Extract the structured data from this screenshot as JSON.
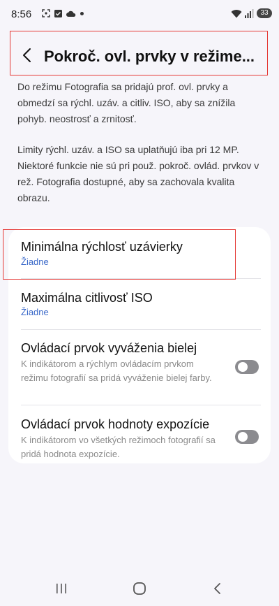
{
  "status_bar": {
    "time": "8:56",
    "battery": "33",
    "left_icons": [
      "screenshot-icon",
      "checkbox-icon",
      "cloud-icon",
      "dot-icon"
    ],
    "right_icons": [
      "wifi-icon",
      "signal-icon",
      "battery-icon"
    ]
  },
  "header": {
    "title": "Pokroč. ovl. prvky v režime..."
  },
  "description": {
    "paragraph1": "Do režimu Fotografia sa pridajú prof. ovl. prvky a obmedzí sa rýchl. uzáv. a citliv. ISO, aby sa znížila pohyb. neostrosť a zrnitosť.",
    "paragraph2": "Limity rýchl. uzáv. a ISO sa uplatňujú iba pri 12 MP. Niektoré funkcie nie sú pri použ. pokroč. ovlád. prvkov v rež. Fotografia dostupné, aby sa zachovala kvalita obrazu."
  },
  "settings": [
    {
      "title": "Minimálna rýchlosť uzávierky",
      "value": "Žiadne"
    },
    {
      "title": "Maximálna citlivosť ISO",
      "value": "Žiadne"
    },
    {
      "title": "Ovládací prvok vyváženia bielej",
      "subtitle": "K indikátorom a rýchlym ovládacím prvkom režimu fotografií sa pridá vyváženie bielej farby.",
      "toggle": "off"
    },
    {
      "title": "Ovládací prvok hodnoty expozície",
      "subtitle": "K indikátorom vo všetkých režimoch fotografií sa pridá hodnota expozície.",
      "toggle": "off"
    }
  ],
  "colors": {
    "accent_value": "#3867c8",
    "highlight": "#e53935",
    "toggle_off": "#8b8b8f"
  },
  "navbar": {
    "buttons": [
      "recents-icon",
      "home-icon",
      "back-icon"
    ]
  }
}
